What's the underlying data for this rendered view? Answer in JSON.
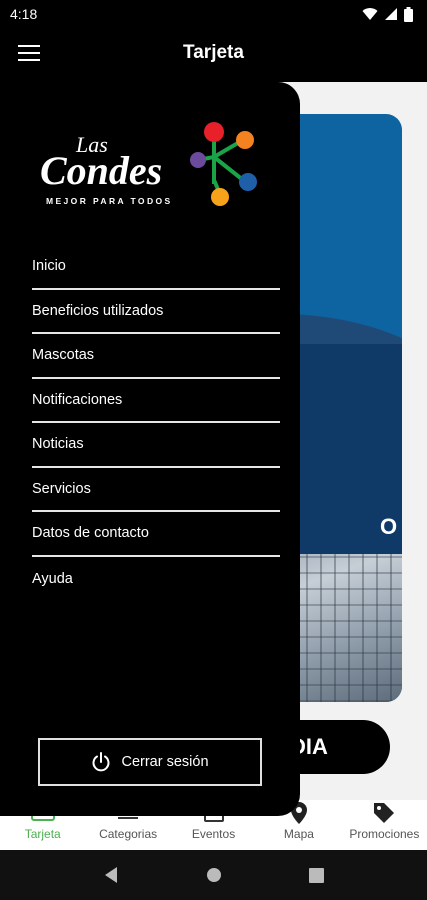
{
  "status_bar": {
    "time": "4:18"
  },
  "app_bar": {
    "title": "Tarjeta"
  },
  "drawer": {
    "logo": {
      "brand_line1": "Las",
      "brand_line2": "Condes",
      "tagline": "MEJOR PARA TODOS"
    },
    "menu_items": [
      "Inicio",
      "Beneficios utilizados",
      "Mascotas",
      "Notificaciones",
      "Noticias",
      "Servicios",
      "Datos de contacto",
      "Ayuda"
    ],
    "logout_label": "Cerrar sesión"
  },
  "background": {
    "card_partial_text": "O",
    "pill_partial_text": "DIA"
  },
  "bottom_nav": [
    {
      "label": "Tarjeta",
      "icon": "card-icon",
      "active": true
    },
    {
      "label": "Categorias",
      "icon": "list-icon",
      "active": false
    },
    {
      "label": "Eventos",
      "icon": "calendar-icon",
      "active": false
    },
    {
      "label": "Mapa",
      "icon": "map-pin-icon",
      "active": false
    },
    {
      "label": "Promociones",
      "icon": "tag-icon",
      "active": false
    }
  ],
  "colors": {
    "accent_active": "#4caf50",
    "card_blue": "#0e64a0",
    "drawer_bg": "#000000",
    "logo_red": "#e8202a",
    "logo_orange": "#f58220",
    "logo_purple": "#6c4a9c",
    "logo_blue": "#1f5fa8",
    "logo_yellow": "#f7a21b",
    "logo_green": "#1aa447"
  }
}
